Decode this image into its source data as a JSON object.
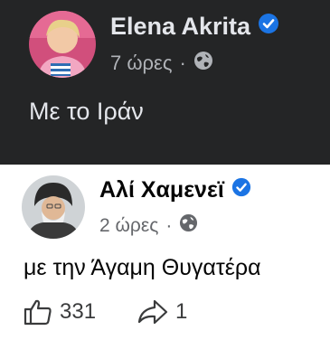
{
  "posts": [
    {
      "author": "Elena Akrita",
      "time": "7 ώρες",
      "separator": "·",
      "privacy_icon": "globe-icon",
      "verified_icon": "verified-badge-icon",
      "text": "Με το Ιράν"
    },
    {
      "author": "Αλί Χαμενεϊ",
      "time": "2 ώρες",
      "separator": "·",
      "privacy_icon": "globe-icon",
      "verified_icon": "verified-badge-icon",
      "text": "με την Άγαμη Θυγατέρα",
      "likes": "331",
      "shares": "1"
    }
  ],
  "colors": {
    "dark_bg": "#242526",
    "light_bg": "#ffffff",
    "verified_blue": "#1b74e4"
  }
}
